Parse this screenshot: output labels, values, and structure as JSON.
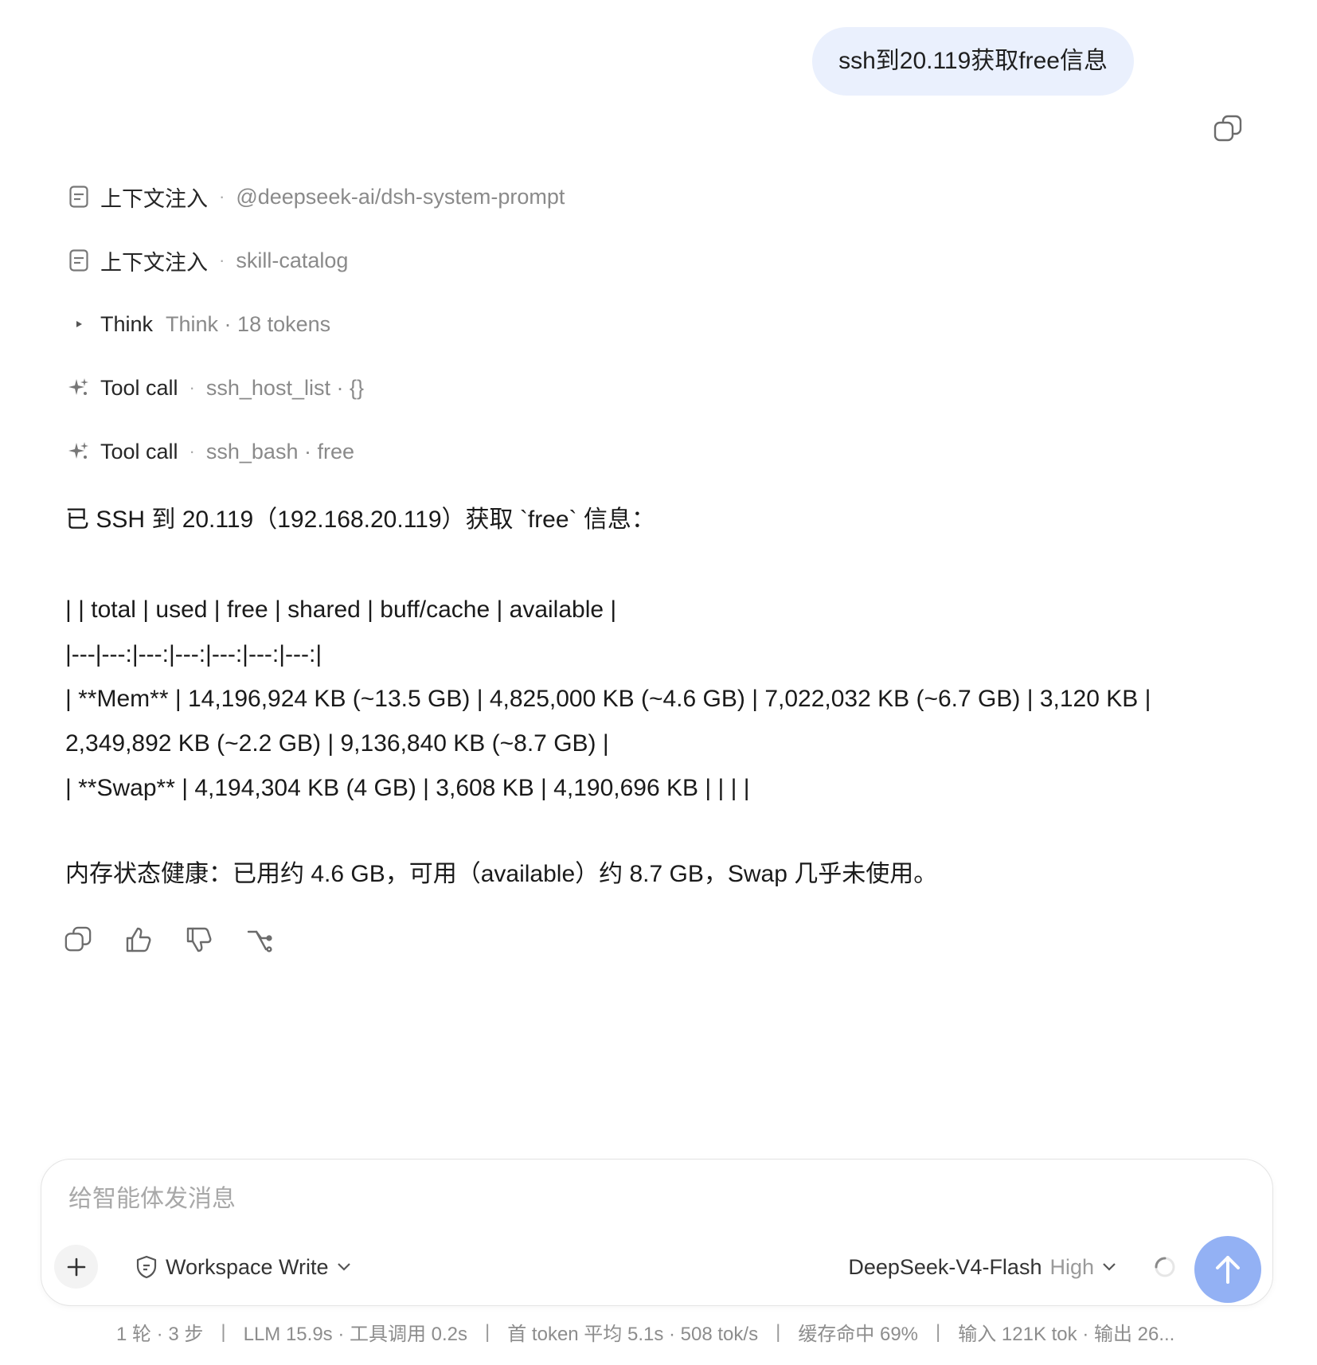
{
  "user_message": "ssh到20.119获取free信息",
  "trace": [
    {
      "icon": "document-icon",
      "kind": "上下文注入",
      "detail": "@deepseek-ai/dsh-system-prompt"
    },
    {
      "icon": "document-icon",
      "kind": "上下文注入",
      "detail": "skill-catalog"
    },
    {
      "icon": "triangle-right-icon",
      "kind": "Think",
      "detail": "Think · 18 tokens"
    },
    {
      "icon": "sparkle-icon",
      "kind": "Tool call",
      "detail": "ssh_host_list · {}"
    },
    {
      "icon": "sparkle-icon",
      "kind": "Tool call",
      "detail": "ssh_bash · free"
    }
  ],
  "answer": {
    "intro": "已 SSH 到 20.119（192.168.20.119）获取 `free` 信息：",
    "table_lines": [
      "| | total | used | free | shared | buff/cache | available |",
      "|---|---:|---:|---:|---:|---:|---:|",
      "| **Mem** | 14,196,924 KB (~13.5 GB) | 4,825,000 KB (~4.6 GB) | 7,022,032 KB (~6.7 GB) | 3,120 KB |",
      "2,349,892 KB (~2.2 GB) | 9,136,840 KB (~8.7 GB) |",
      "| **Swap** | 4,194,304 KB (4 GB) | 3,608 KB | 4,190,696 KB | | | |"
    ],
    "summary": "内存状态健康：已用约 4.6 GB，可用（available）约 8.7 GB，Swap 几乎未使用。"
  },
  "composer": {
    "placeholder": "给智能体发消息",
    "value": "",
    "mode_label": "Workspace Write",
    "model_name": "DeepSeek-V4-Flash",
    "model_effort": "High"
  },
  "stats": {
    "rounds": "1 轮 · 3 步",
    "llm": "LLM 15.9s · 工具调用 0.2s",
    "first_token": "首 token 平均 5.1s · 508 tok/s",
    "cache": "缓存命中 69%",
    "io": "输入 121K tok · 输出 26..."
  },
  "colors": {
    "user_bubble": "#eaf0fd",
    "send_button": "#93b1f4",
    "muted_text": "#8a8a8a"
  }
}
